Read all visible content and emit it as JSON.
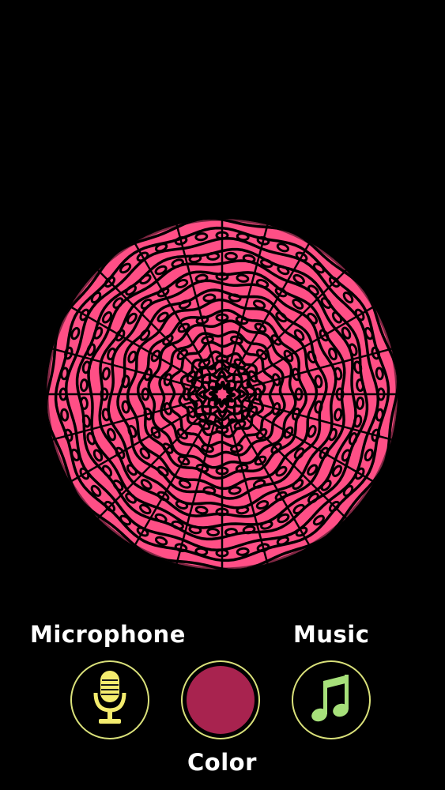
{
  "visualizer": {
    "fill_color": "#ff4f86",
    "pattern_color": "#000000"
  },
  "controls": {
    "microphone": {
      "label": "Microphone",
      "icon": "microphone-icon",
      "icon_color": "#f4ec6e"
    },
    "color": {
      "label": "Color",
      "swatch_color": "#a8234f"
    },
    "music": {
      "label": "Music",
      "icon": "music-note-icon",
      "icon_color": "#a6e07a"
    }
  },
  "theme": {
    "background": "#000000",
    "ring_color": "#d9e07a",
    "label_color": "#ffffff"
  }
}
